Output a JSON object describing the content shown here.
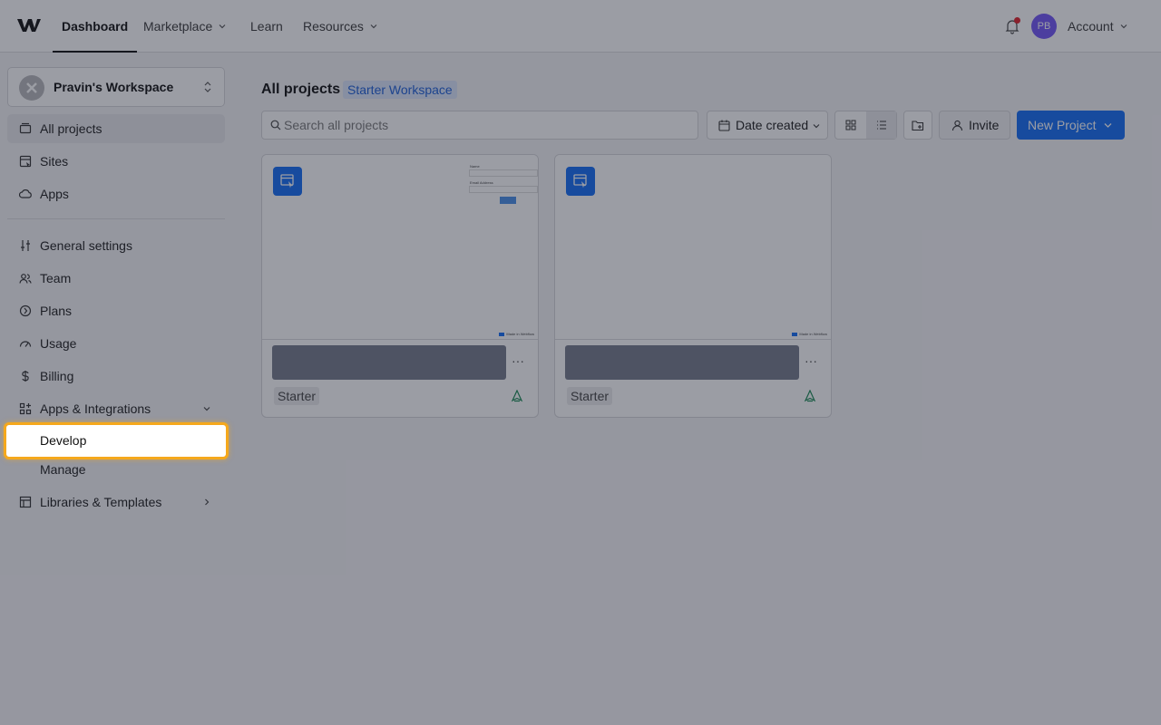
{
  "topnav": {
    "items": [
      {
        "label": "Dashboard",
        "active": true
      },
      {
        "label": "Marketplace",
        "dropdown": true
      },
      {
        "label": "Learn"
      },
      {
        "label": "Resources",
        "dropdown": true
      }
    ],
    "avatar_initials": "PB",
    "account_label": "Account"
  },
  "sidebar": {
    "workspace_name": "Pravin's Workspace",
    "items": [
      {
        "label": "All projects",
        "icon": "folder-icon",
        "selected": true
      },
      {
        "label": "Sites",
        "icon": "sites-icon"
      },
      {
        "label": "Apps",
        "icon": "cloud-icon"
      },
      {
        "label": "General settings",
        "icon": "sliders-icon"
      },
      {
        "label": "Team",
        "icon": "users-icon"
      },
      {
        "label": "Plans",
        "icon": "plans-icon"
      },
      {
        "label": "Usage",
        "icon": "gauge-icon"
      },
      {
        "label": "Billing",
        "icon": "dollar-icon"
      },
      {
        "label": "Apps & Integrations",
        "icon": "apps-grid-icon",
        "expanded": true
      },
      {
        "label": "Develop",
        "highlighted": true
      },
      {
        "label": "Manage"
      },
      {
        "label": "Libraries & Templates",
        "icon": "library-icon",
        "has_submenu": true
      }
    ]
  },
  "main": {
    "title": "All projects",
    "workspace_badge": "Starter Workspace",
    "search_placeholder": "Search all projects",
    "sort_label": "Date created",
    "invite_label": "Invite",
    "new_project_label": "New Project",
    "projects": [
      {
        "plan": "Starter",
        "thumb_has_form": true,
        "form_labels": [
          "Name",
          "Email Address"
        ],
        "made_in": "Made in Webflow"
      },
      {
        "plan": "Starter",
        "thumb_has_form": false,
        "made_in": "Made in Webflow"
      }
    ]
  },
  "colors": {
    "accent": "#146ef5",
    "highlight": "#f5a81c",
    "overlay": "rgba(28,32,48,0.44)"
  }
}
